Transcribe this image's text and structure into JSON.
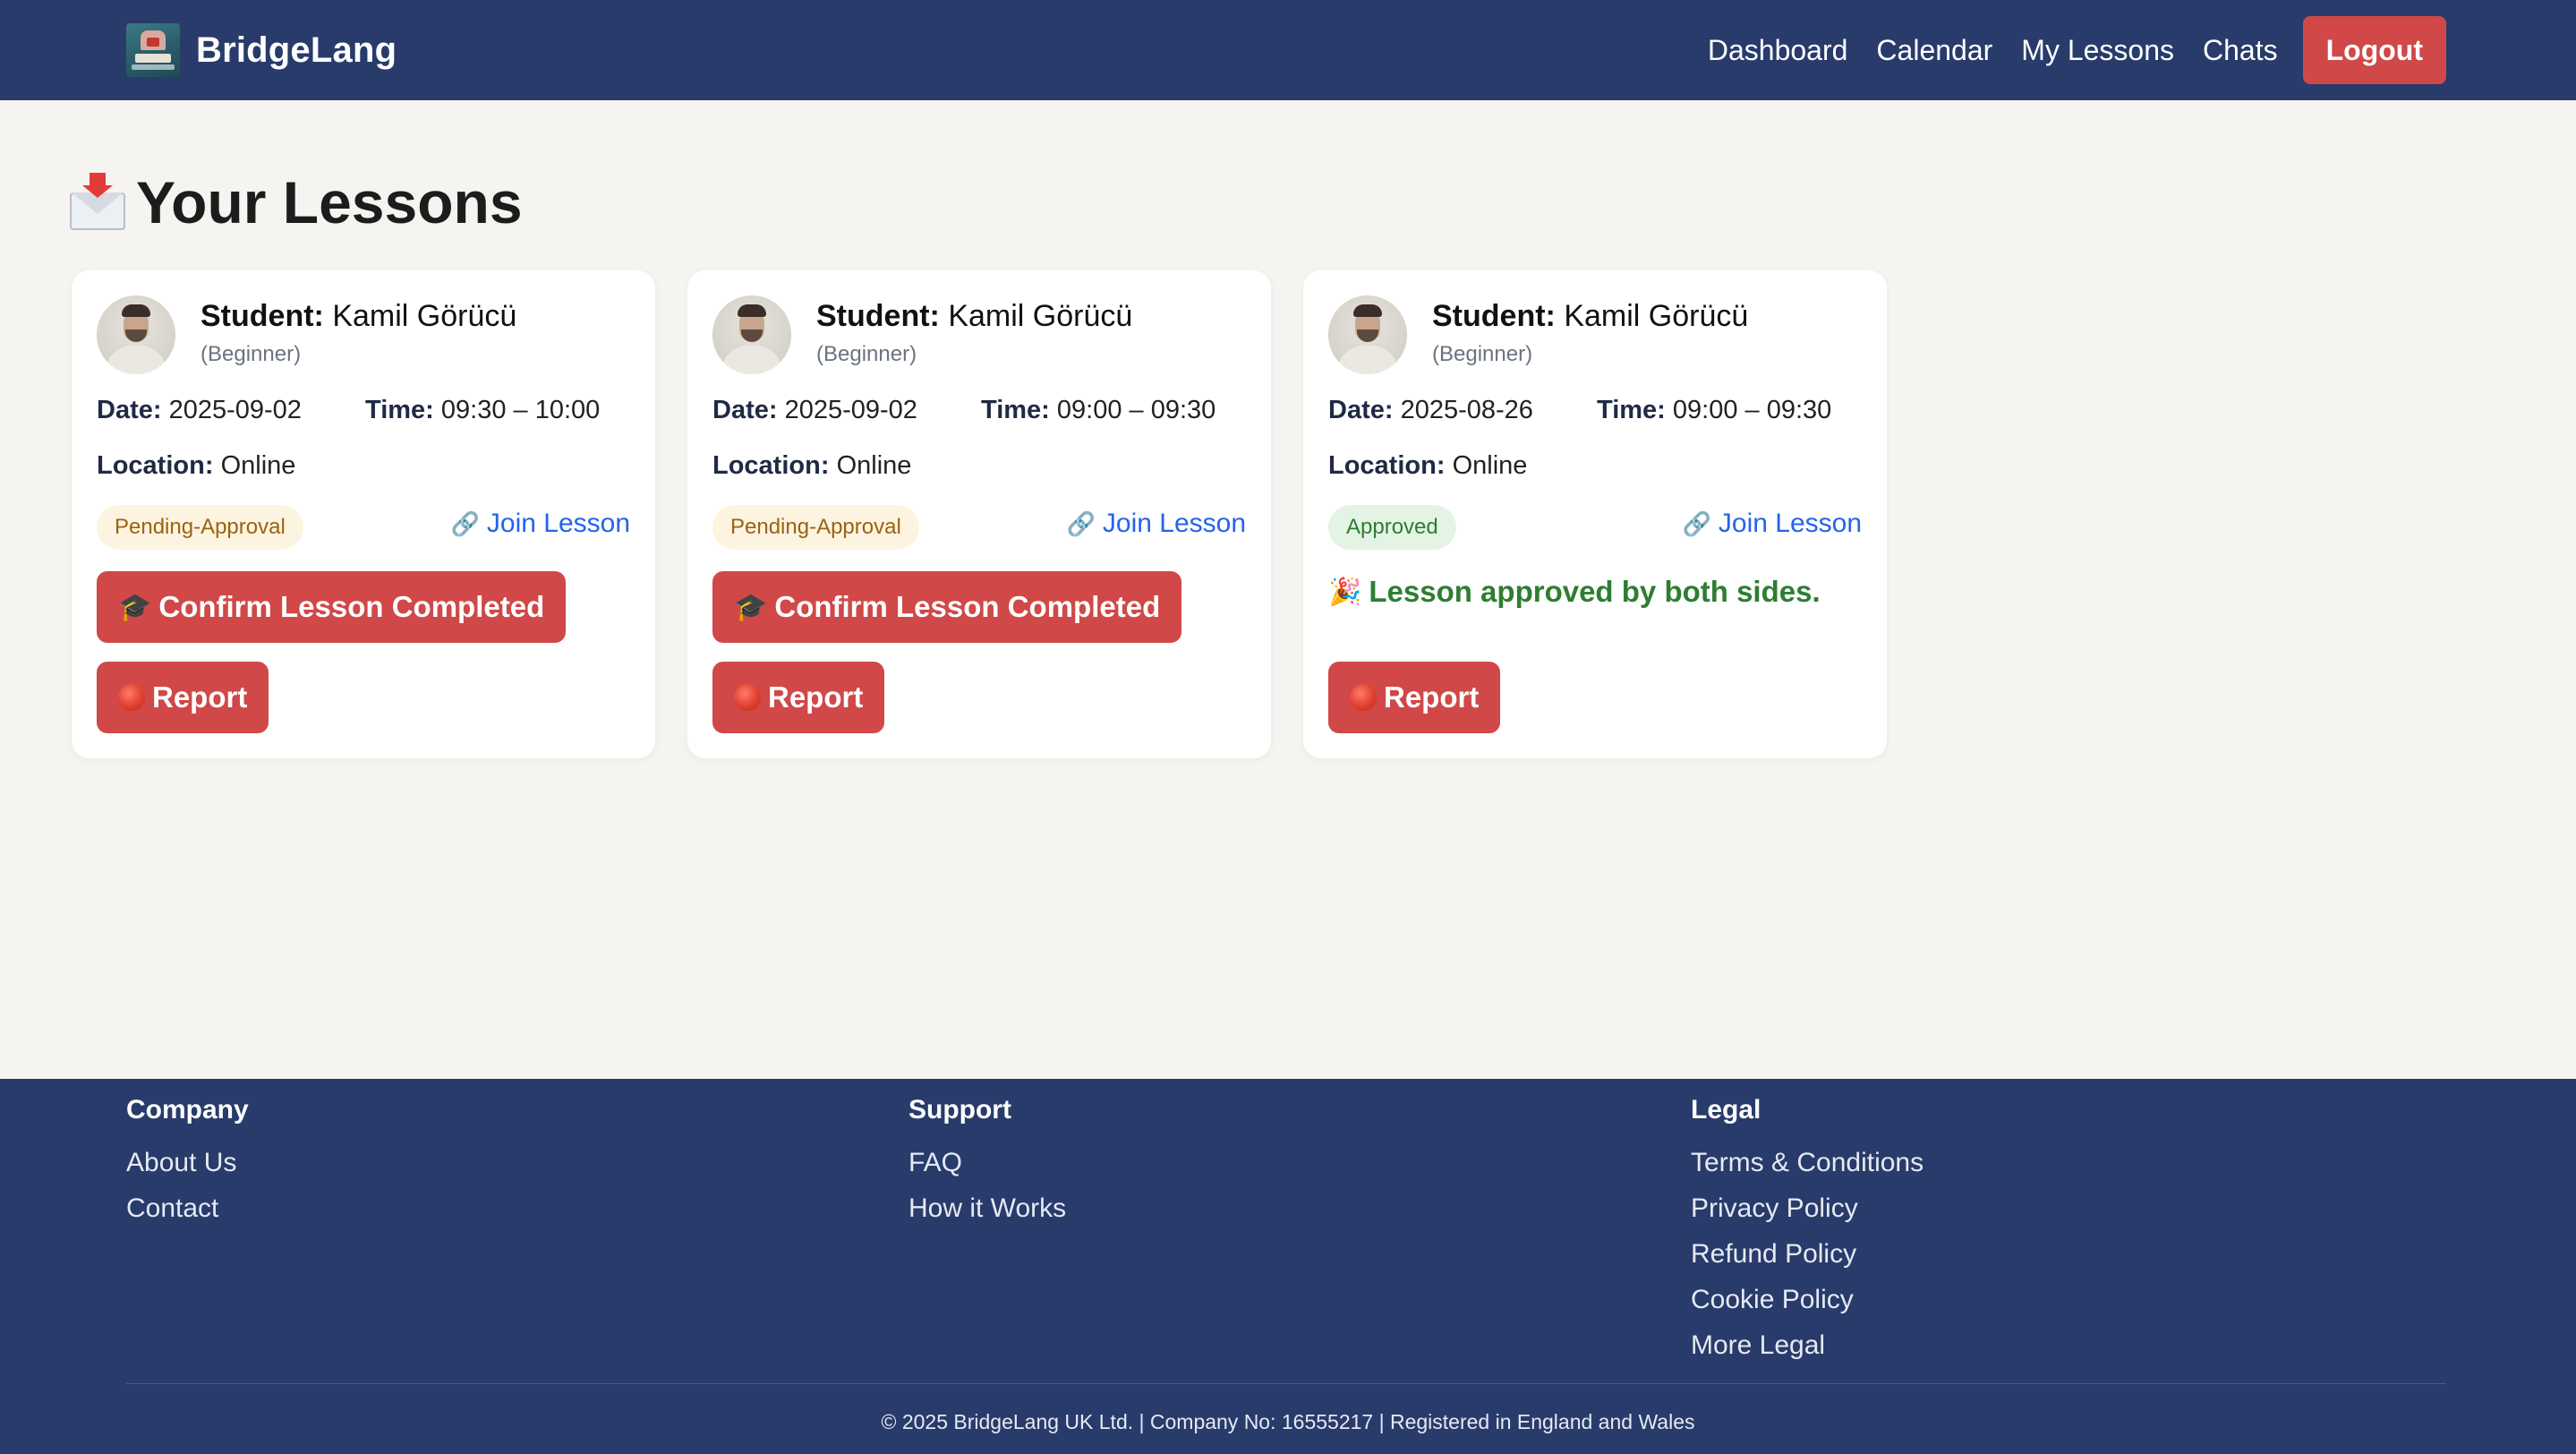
{
  "nav": {
    "brand": "BridgeLang",
    "links": [
      "Dashboard",
      "Calendar",
      "My Lessons",
      "Chats"
    ],
    "logout": "Logout"
  },
  "page": {
    "title": "Your Lessons"
  },
  "labels": {
    "student": "Student:",
    "date": "Date:",
    "time": "Time:",
    "location": "Location:",
    "join": "Join Lesson",
    "confirm": "Confirm Lesson Completed",
    "report": "Report"
  },
  "lessons": [
    {
      "student": "Kamil Görücü",
      "level": "(Beginner)",
      "date": "2025-09-02",
      "time": "09:30 – 10:00",
      "location": "Online",
      "status": "Pending-Approval"
    },
    {
      "student": "Kamil Görücü",
      "level": "(Beginner)",
      "date": "2025-09-02",
      "time": "09:00 – 09:30",
      "location": "Online",
      "status": "Pending-Approval"
    },
    {
      "student": "Kamil Görücü",
      "level": "(Beginner)",
      "date": "2025-08-26",
      "time": "09:00 – 09:30",
      "location": "Online",
      "status": "Approved",
      "approved_message": "Lesson approved by both sides."
    }
  ],
  "footer": {
    "company": {
      "heading": "Company",
      "links": [
        "About Us",
        "Contact"
      ]
    },
    "support": {
      "heading": "Support",
      "links": [
        "FAQ",
        "How it Works"
      ]
    },
    "legal": {
      "heading": "Legal",
      "links": [
        "Terms & Conditions",
        "Privacy Policy",
        "Refund Policy",
        "Cookie Policy",
        "More Legal"
      ]
    },
    "copyright": "© 2025 BridgeLang UK Ltd. | Company No: 16555217 | Registered in England and Wales"
  },
  "colors": {
    "nav_bg": "#283b6b",
    "page_bg": "#f5f4f0",
    "accent_red": "#d04848",
    "link_blue": "#2563eb",
    "success_green": "#2e7d32"
  },
  "icons": {
    "title": "envelope-with-arrow-icon",
    "join": "link-icon",
    "confirm": "graduation-cap-icon",
    "report": "stop-sign-icon",
    "approved": "party-popper-icon"
  }
}
